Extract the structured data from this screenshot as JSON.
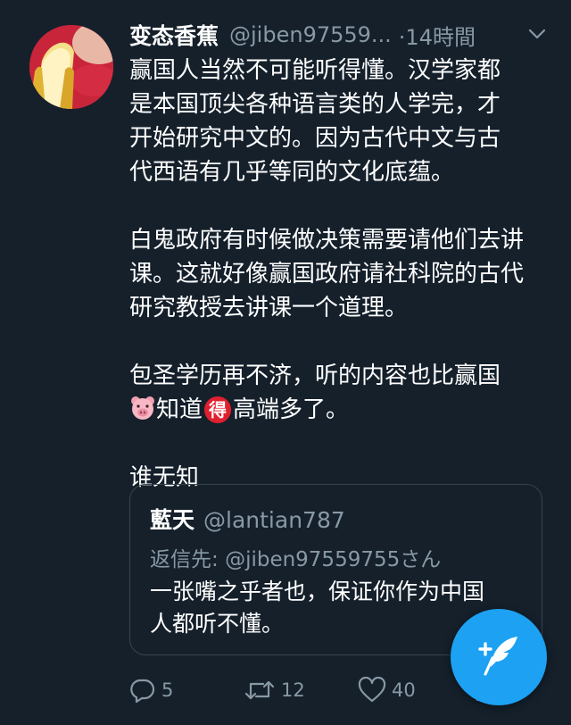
{
  "tweet": {
    "author_name": "变态香蕉",
    "author_handle": "@jiben97559...",
    "time": "·14時間",
    "paragraphs": [
      [
        "赢国人当然不可能听得懂。汉学家都",
        "是本国顶尖各种语言类的人学完，才",
        "开始研究中文的。因为古代中文与古",
        "代西语有几乎等同的文化底蕴。"
      ],
      [
        "白鬼政府有时候做决策需要请他们去讲",
        "课。这就好像赢国政府请社科院的古代",
        "研究教授去讲课一个道理。"
      ]
    ],
    "para3_line1": "包圣学历再不济，听的内容也比赢国",
    "para3_line2_a": "知道",
    "emoji_de": "得",
    "para3_line2_b": "高端多了。",
    "closing": "谁无知"
  },
  "quote": {
    "name": "藍天",
    "handle": "@lantian787",
    "reply_label": "返信先: ",
    "reply_handle": "@jiben97559755",
    "reply_suffix": "さん",
    "lines": [
      "一张嘴之乎者也，保证你作为中国",
      "人都听不懂。"
    ]
  },
  "actions": {
    "replies": "5",
    "retweets": "12",
    "likes": "40"
  },
  "icons": {
    "avatar": "banana-avatar",
    "menu": "chevron-down-icon",
    "reply": "reply-icon",
    "retweet": "retweet-icon",
    "like": "heart-icon",
    "share": "share-icon",
    "compose": "compose-tweet-icon",
    "emoji_pig": "pig-face-emoji"
  },
  "colors": {
    "background": "#15202b",
    "text": "#ffffff",
    "secondary": "#8899a6",
    "accent": "#1da1f2",
    "border": "#38444d"
  }
}
